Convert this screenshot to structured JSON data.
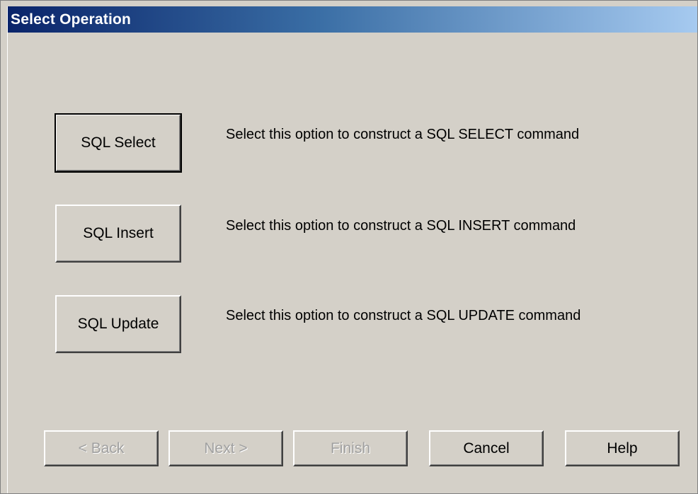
{
  "window": {
    "title": "Select Operation"
  },
  "options": [
    {
      "button_label": "SQL Select",
      "description": "Select this option to construct a SQL SELECT command"
    },
    {
      "button_label": "SQL Insert",
      "description": "Select this option to construct a SQL INSERT command"
    },
    {
      "button_label": "SQL Update",
      "description": "Select this option to construct a SQL UPDATE command"
    }
  ],
  "footer": {
    "back_label": "< Back",
    "next_label": "Next >",
    "finish_label": "Finish",
    "cancel_label": "Cancel",
    "help_label": "Help"
  },
  "colors": {
    "titlebar_start": "#0a246a",
    "titlebar_end": "#a6caf0",
    "dialog_background": "#d4d0c8",
    "disabled_text": "#a0a0a0"
  }
}
